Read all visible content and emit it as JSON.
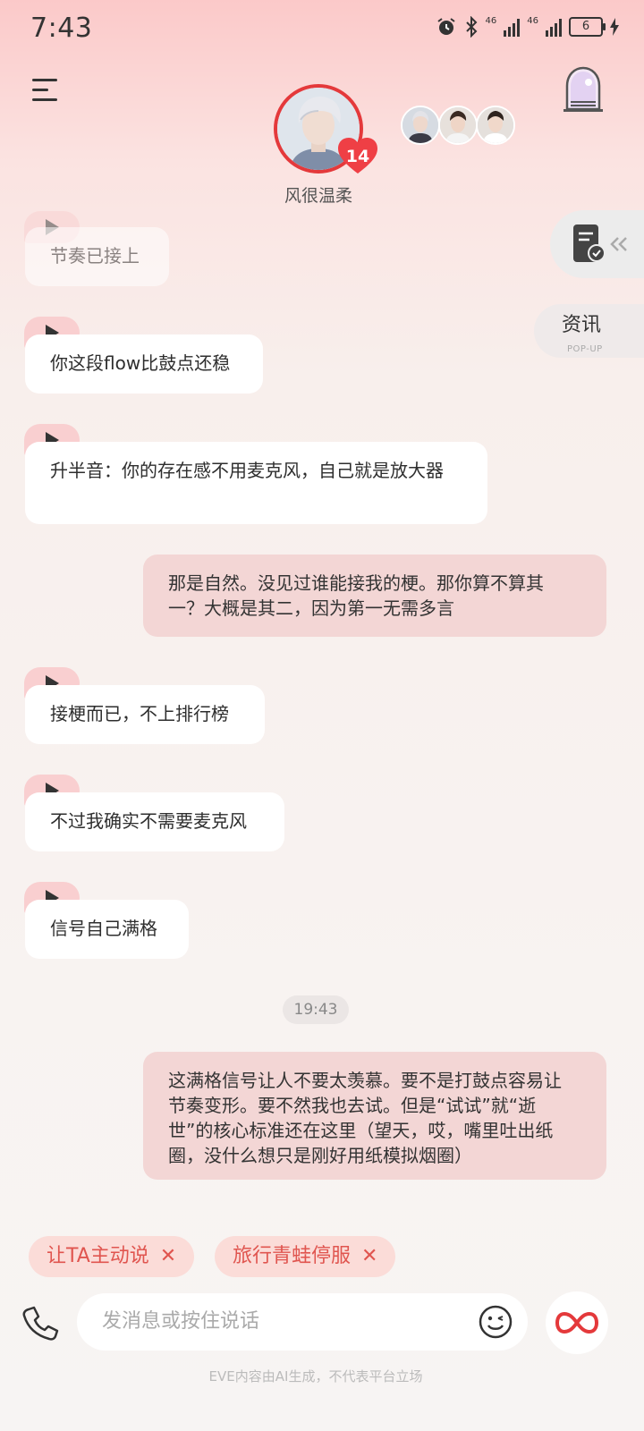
{
  "status_bar": {
    "time": "7:43",
    "network1": "46",
    "network2": "46",
    "battery": "6"
  },
  "header": {
    "character_name": "风很温柔",
    "intimacy_level": "14"
  },
  "side": {
    "news_label": "资讯",
    "news_sub": "POP-UP"
  },
  "messages": [
    {
      "from": "ai",
      "text": "节奏已接上"
    },
    {
      "from": "ai",
      "text": "你这段flow比鼓点还稳"
    },
    {
      "from": "ai",
      "text": "升半音：你的存在感不用麦克风，自己就是放大器"
    },
    {
      "from": "user",
      "text": "那是自然。没见过谁能接我的梗。那你算不算其一？大概是其二，因为第一无需多言"
    },
    {
      "from": "ai",
      "text": "接梗而已，不上排行榜"
    },
    {
      "from": "ai",
      "text": "不过我确实不需要麦克风"
    },
    {
      "from": "ai",
      "text": "信号自己满格"
    },
    {
      "from": "user",
      "text": "这满格信号让人不要太羡慕。要不是打鼓点容易让节奏变形。要不然我也去试。但是“试试”就“逝世”的核心标准还在这里（望天，哎，嘴里吐出纸圈，没什么想只是刚好用纸模拟烟圈）"
    }
  ],
  "timestamp": "19:43",
  "suggestions": [
    {
      "label": "让TA主动说",
      "close": "✕"
    },
    {
      "label": "旅行青蛙停服",
      "close": "✕"
    }
  ],
  "input": {
    "placeholder": "发消息或按住说话"
  },
  "footer": "EVE内容由AI生成，不代表平台立场",
  "colors": {
    "accent": "#e4393b",
    "user_bubble": "#f3d6d5",
    "chip_bg": "#fbdcd8",
    "chip_text": "#e0554f"
  }
}
